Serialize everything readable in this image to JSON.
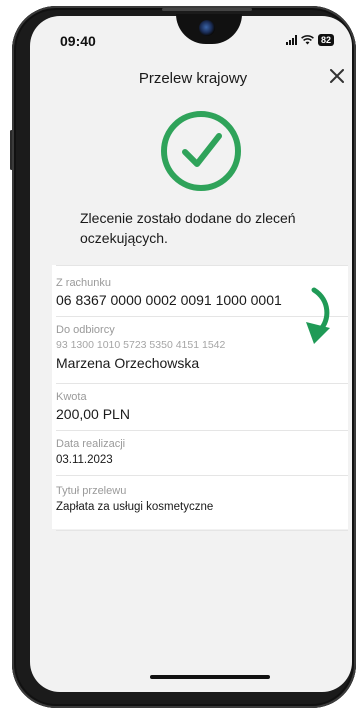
{
  "status": {
    "time": "09:40",
    "battery": "82"
  },
  "header": {
    "title": "Przelew krajowy",
    "close_icon": "close-icon"
  },
  "result": {
    "icon": "check-circle-icon",
    "message": "Zlecenie zostało dodane do zleceń oczekujących."
  },
  "colors": {
    "accent": "#2fa35a",
    "screen_bg": "#f2f2f2"
  },
  "details": {
    "from_label": "Z rachunku",
    "from_value": "06 8367 0000 0002 0091 1000 0001",
    "to_label": "Do odbiorcy",
    "to_account": "93 1300 1010 5723 5350 4151 1542",
    "to_name": "Marzena Orzechowska",
    "amount_label": "Kwota",
    "amount_value": "200,00 PLN",
    "date_label": "Data realizacji",
    "date_value": "03.11.2023",
    "title_label": "Tytuł przelewu",
    "title_value": "Zapłata za usługi kosmetyczne"
  },
  "annotation_icon": "curved-arrow-down-icon"
}
